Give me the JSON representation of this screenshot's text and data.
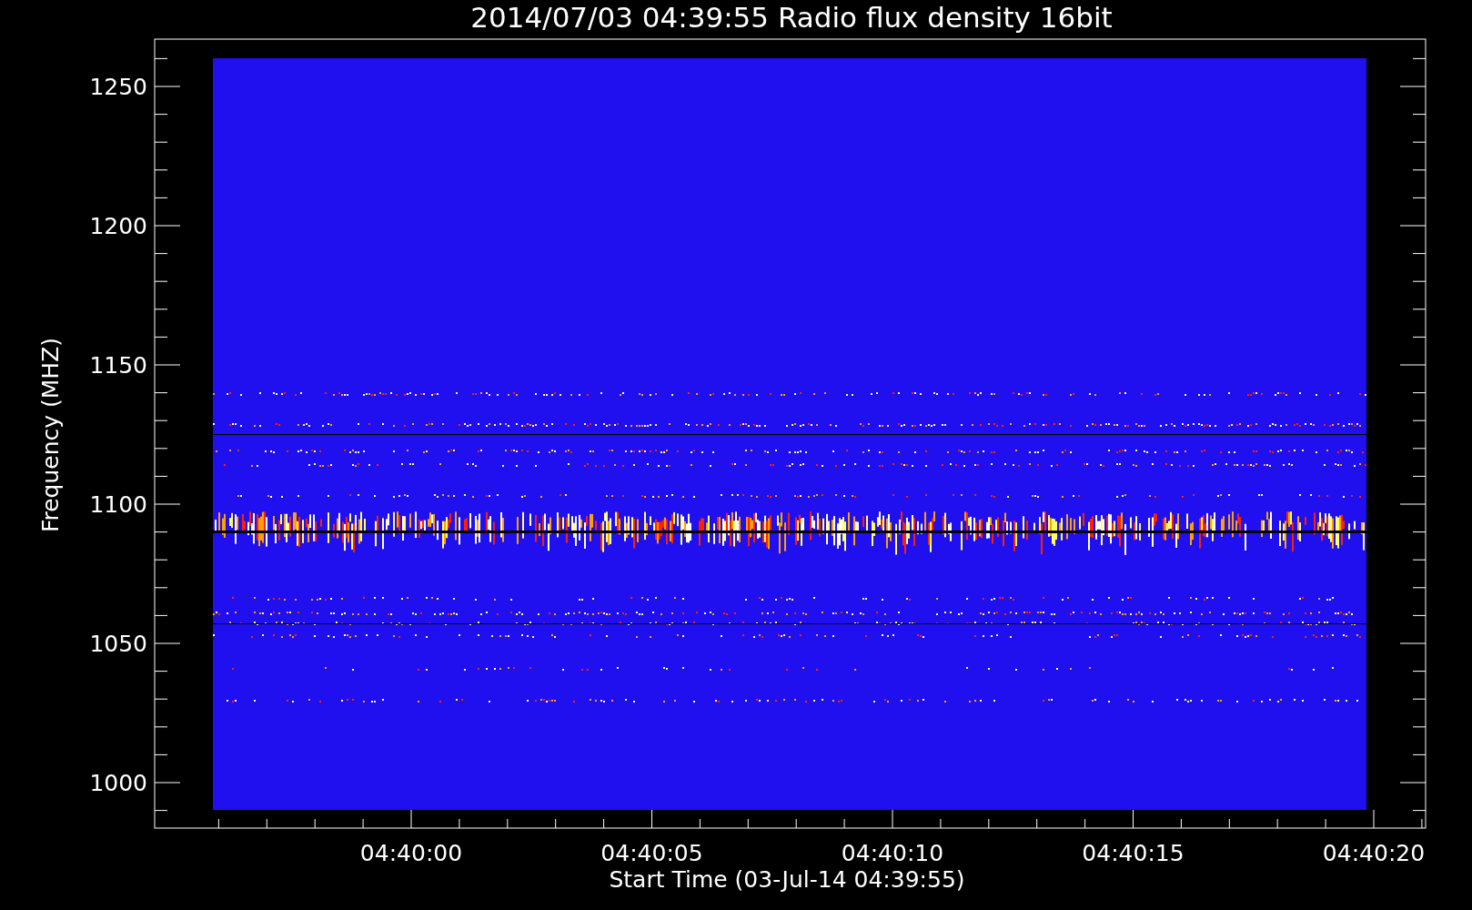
{
  "plot": {
    "title": "2014/07/03 04:39:55 Radio flux density 16bit",
    "ylabel": "Frequency (MHZ)",
    "xlabel": "Start Time (03-Jul-14 04:39:55)",
    "yticks": [
      "1250",
      "1200",
      "1150",
      "1100",
      "1050",
      "1000"
    ],
    "xticks": [
      "04:40:00",
      "04:40:05",
      "04:40:10",
      "04:40:15",
      "04:40:20"
    ]
  }
}
